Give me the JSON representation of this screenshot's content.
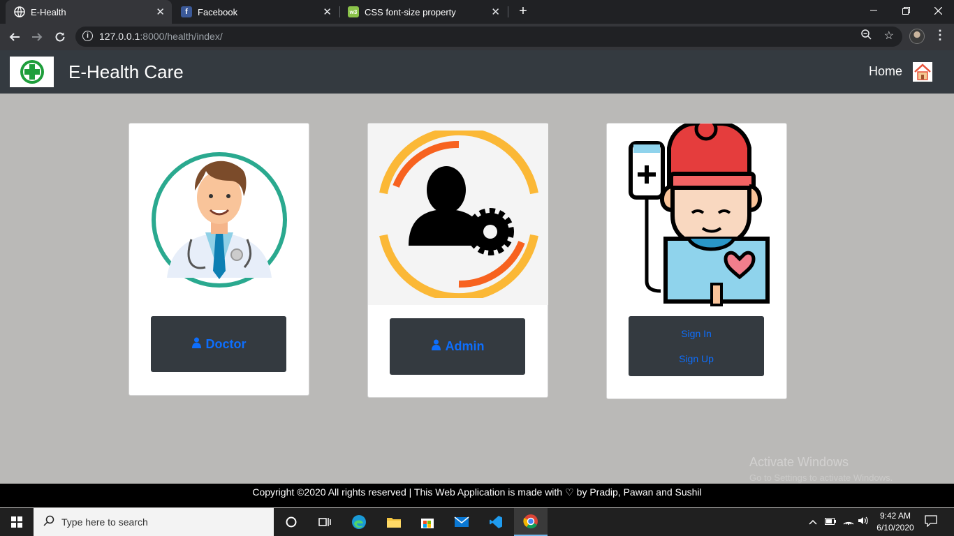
{
  "browser": {
    "tabs": [
      {
        "title": "E-Health",
        "active": true
      },
      {
        "title": "Facebook",
        "active": false
      },
      {
        "title": "CSS font-size property",
        "active": false
      }
    ],
    "close_glyph": "✕",
    "new_tab_glyph": "+",
    "url_host": "127.0.0.1",
    "url_path": ":8000/health/index/"
  },
  "site": {
    "brand": "E-Health Care",
    "nav_home": "Home"
  },
  "cards": {
    "doctor": {
      "button_label": "Doctor"
    },
    "admin": {
      "button_label": "Admin"
    },
    "patient": {
      "sign_in": "Sign In",
      "sign_up": "Sign Up"
    }
  },
  "footer": {
    "text_before": "Copyright ©2020 All rights reserved | This Web Application is made with",
    "heart_glyph": "♡",
    "text_after": "by Pradip, Pawan and Sushil"
  },
  "watermark": {
    "title": "Activate Windows",
    "subtitle": "Go to Settings to activate Windows."
  },
  "taskbar": {
    "search_placeholder": "Type here to search",
    "time": "9:42 AM",
    "date": "6/10/2020"
  },
  "colors": {
    "navbar": "#343a40",
    "page_bg": "#bab9b7",
    "link_blue": "#0d6efd",
    "health_green": "#1e9e3b"
  }
}
